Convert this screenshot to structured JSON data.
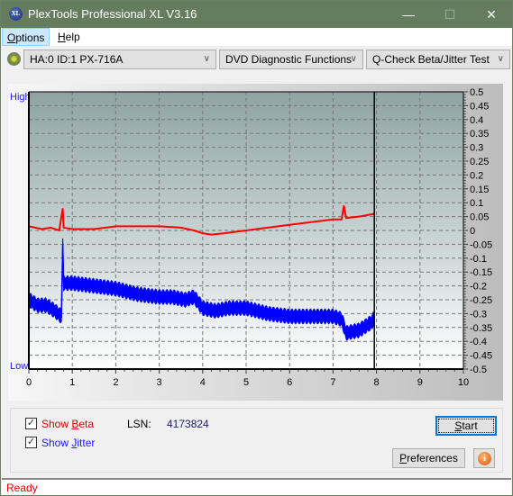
{
  "window": {
    "title": "PlexTools Professional XL V3.16",
    "app_icon_text": "XL",
    "minimize": "—",
    "maximize": "☐",
    "close": "✕"
  },
  "menu": {
    "items": [
      {
        "label": "Options",
        "mnemonic": "O",
        "rest": "ptions"
      },
      {
        "label": "Help",
        "mnemonic": "H",
        "rest": "elp"
      }
    ]
  },
  "toolbar": {
    "drive": "HA:0 ID:1  PX-716A",
    "function": "DVD Diagnostic Functions",
    "test": "Q-Check Beta/Jitter Test",
    "chevron": "∨"
  },
  "chart_data": {
    "type": "line",
    "left_axis_labels": {
      "high": "High",
      "low": "Low"
    },
    "x_ticks": [
      "0",
      "1",
      "2",
      "3",
      "4",
      "5",
      "6",
      "7",
      "8",
      "9",
      "10"
    ],
    "xlim": [
      0,
      10
    ],
    "y_ticks": [
      "0.5",
      "0.45",
      "0.4",
      "0.35",
      "0.3",
      "0.25",
      "0.2",
      "0.15",
      "0.1",
      "0.05",
      "0",
      "-0.05",
      "-0.1",
      "-0.15",
      "-0.2",
      "-0.25",
      "-0.3",
      "-0.35",
      "-0.4",
      "-0.45",
      "-0.5"
    ],
    "ylim": [
      -0.5,
      0.5
    ],
    "grid": true,
    "cursor_x": 7.95,
    "colors": {
      "beta": "#ff0000",
      "jitter": "#0000ff"
    },
    "series": [
      {
        "name": "Beta",
        "x": [
          0.0,
          0.3,
          0.5,
          0.7,
          0.78,
          0.8,
          1.0,
          1.5,
          2.0,
          2.5,
          3.0,
          3.5,
          3.8,
          4.0,
          4.2,
          4.5,
          5.0,
          5.5,
          6.0,
          6.5,
          7.0,
          7.2,
          7.25,
          7.3,
          7.6,
          7.95
        ],
        "y": [
          0.015,
          0.005,
          0.01,
          0.0,
          0.08,
          0.01,
          0.005,
          0.005,
          0.015,
          0.015,
          0.015,
          0.01,
          0.0,
          -0.01,
          -0.015,
          -0.01,
          0.0,
          0.01,
          0.02,
          0.03,
          0.04,
          0.04,
          0.09,
          0.045,
          0.05,
          0.06
        ]
      },
      {
        "name": "Jitter",
        "x": [
          0.0,
          0.2,
          0.4,
          0.6,
          0.75,
          0.78,
          0.8,
          1.0,
          1.5,
          2.0,
          2.5,
          3.0,
          3.3,
          3.6,
          3.8,
          4.0,
          4.3,
          4.6,
          5.0,
          5.5,
          6.0,
          6.5,
          7.0,
          7.2,
          7.3,
          7.6,
          7.9,
          7.95
        ],
        "y": [
          -0.25,
          -0.27,
          -0.27,
          -0.29,
          -0.31,
          -0.05,
          -0.19,
          -0.19,
          -0.2,
          -0.21,
          -0.23,
          -0.24,
          -0.24,
          -0.25,
          -0.24,
          -0.28,
          -0.29,
          -0.28,
          -0.28,
          -0.3,
          -0.31,
          -0.31,
          -0.31,
          -0.32,
          -0.37,
          -0.36,
          -0.33,
          -0.31
        ]
      }
    ]
  },
  "controls": {
    "show_beta": {
      "checked": true,
      "prefix": "Show ",
      "mnemonic": "B",
      "rest": "eta"
    },
    "show_jitter": {
      "checked": true,
      "prefix": "Show ",
      "mnemonic": "J",
      "rest": "itter"
    },
    "lsn_label": "LSN:",
    "lsn_value": "4173824",
    "start_button": {
      "mnemonic": "S",
      "rest": "tart"
    },
    "preferences_button": {
      "mnemonic": "P",
      "rest": "references"
    },
    "info_icon": "i",
    "check_glyph": "✓"
  },
  "status": {
    "text": "Ready"
  }
}
